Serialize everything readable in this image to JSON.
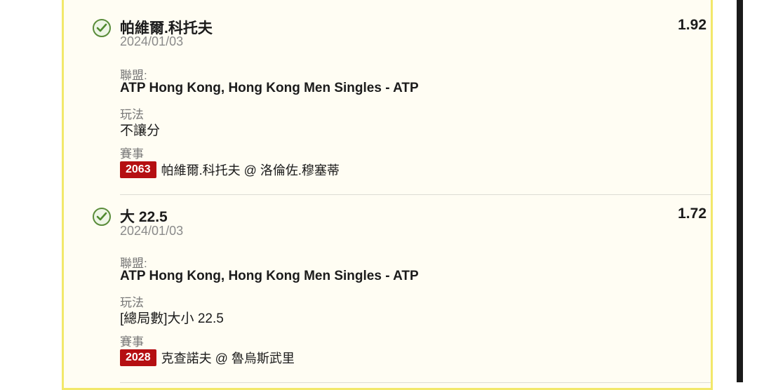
{
  "bets": [
    {
      "selection": "帕維爾.科托夫",
      "odds": "1.92",
      "date": "2024/01/03",
      "league_label": "聯盟:",
      "league": "ATP Hong Kong, Hong Kong Men Singles - ATP",
      "market_label": "玩法",
      "market": "不讓分",
      "event_label": "賽事",
      "event_code": "2063",
      "event_name": "帕維爾.科托夫 @ 洛倫佐.穆塞蒂"
    },
    {
      "selection": "大 22.5",
      "odds": "1.72",
      "date": "2024/01/03",
      "league_label": "聯盟:",
      "league": "ATP Hong Kong, Hong Kong Men Singles - ATP",
      "market_label": "玩法",
      "market": "[總局數]大小 22.5",
      "event_label": "賽事",
      "event_code": "2028",
      "event_name": "克查諾夫 @ 魯烏斯武里"
    }
  ],
  "colors": {
    "panel_bg": "#fffdf3",
    "panel_border": "#f2e86a",
    "badge": "#b50f12",
    "check": "#5a8c3a"
  },
  "icons": [
    "check-circle-icon"
  ]
}
